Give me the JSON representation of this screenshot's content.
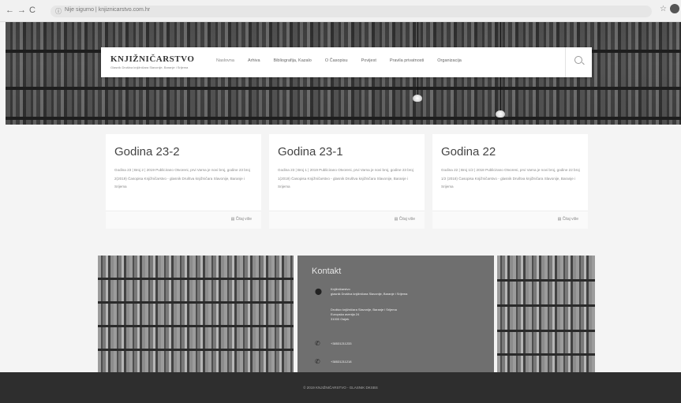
{
  "browser": {
    "back": "←",
    "forward": "→",
    "reload": "C",
    "lock": "ⓘ",
    "url_scheme": "Nije sigurno",
    "url": "knjiznicarstvo.com.hr",
    "star": "☆"
  },
  "header": {
    "site_title": "KNJIŽNIČARSTVO",
    "site_subtitle": "Glasnik Društva knjižničara Slavonije, Baranje i Srijema",
    "menu": [
      {
        "label": "Naslovna"
      },
      {
        "label": "Arhiva"
      },
      {
        "label": "Bibliografija, Kazalo"
      },
      {
        "label": "O Časopisu"
      },
      {
        "label": "Povijest"
      },
      {
        "label": "Pravila privatnosti"
      },
      {
        "label": "Organizacija"
      }
    ]
  },
  "posts": [
    {
      "title": "Godina 23-2",
      "excerpt": "Godina 23 | Broj 2 | 2019 Publicirano Otvoreni, prvi Varna je novi broj, godine 23 broj 2(2019) Časopisa Knjižničarstvo - glasnik Društva knjižničara Slavonije, Baranje i Srijema",
      "read_more": "Čitaj više"
    },
    {
      "title": "Godina 23-1",
      "excerpt": "Godina 23 | Broj 1 | 2019 Publicirano Otvoreni, prvi Varna je novi broj, godine 23 broj 1(2019) Časopisa Knjižničarstvo - glasnik Društva knjižničara Slavonije, Baranje i Srijema",
      "read_more": "Čitaj više"
    },
    {
      "title": "Godina 22",
      "excerpt": "Godina 22 | Broj 1/2 | 2018 Publicirano Otvoreni, prvi Varna je novi broj, godine 22 broj 1/2 (2018) Časopisa Knjižničarstvo - glasnik Društva knjižničara Slavonije, Baranje i Srijema",
      "read_more": "Čitaj više"
    }
  ],
  "contact": {
    "title": "Kontakt",
    "address_line1": "Knjižničarstvo",
    "address_line2": "glasnik Društva knjižničara Slavonije, Baranje i Srijema",
    "address_line3": "Društvo knjižničara Slavonije, Baranje i Srijema",
    "address_line4": "Europska avenija 24",
    "address_line5": "31000 Osijek",
    "phone1": "+38531211233",
    "phone2": "+38531211218"
  },
  "footer": {
    "copyright": "© 2019 KNJIŽNIČARSTVO - GLASNIK DKSBS"
  }
}
